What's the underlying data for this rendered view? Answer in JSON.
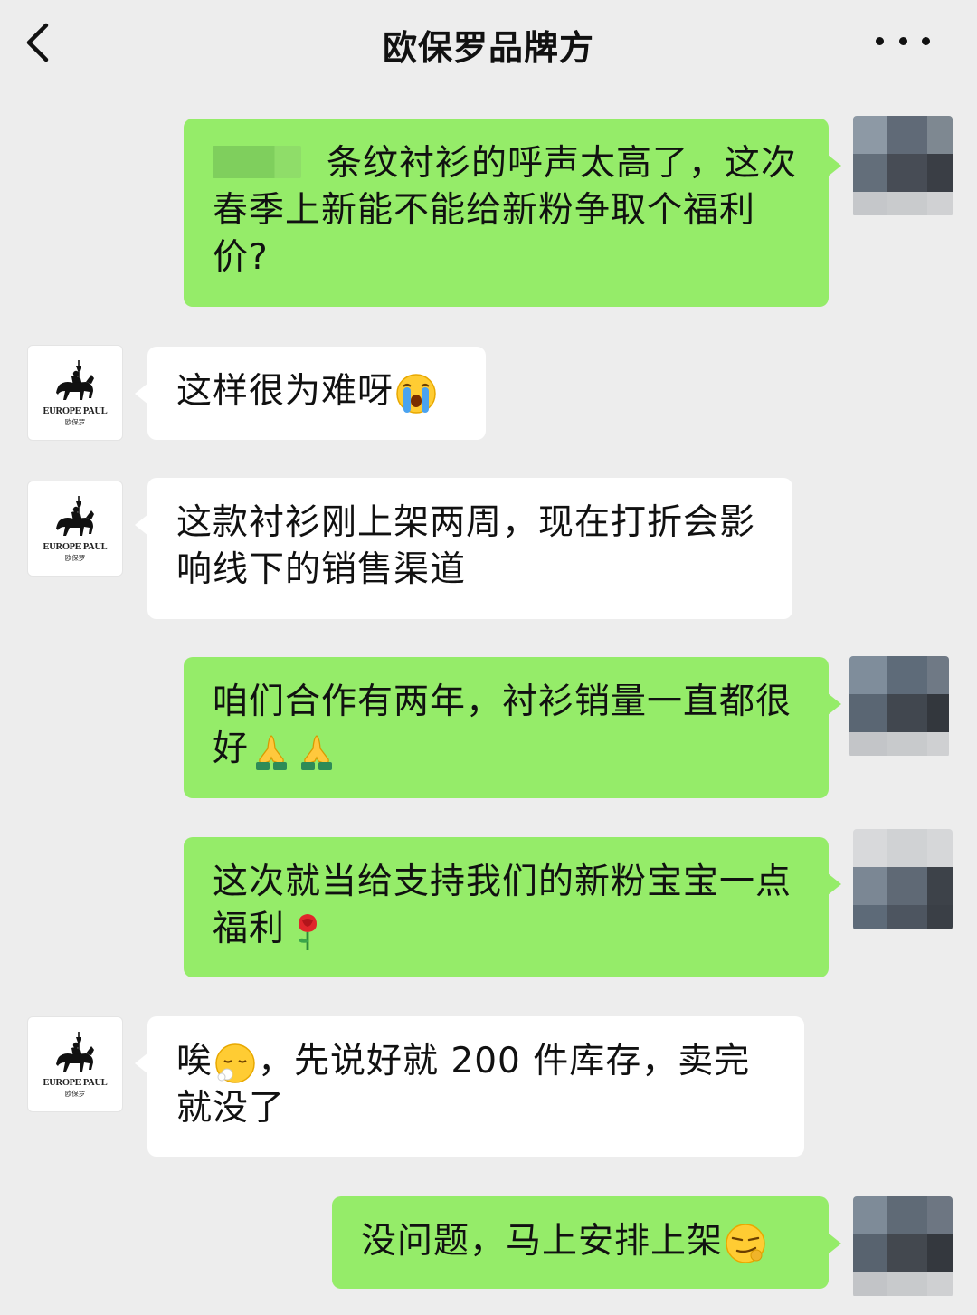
{
  "header": {
    "title": "欧保罗品牌方",
    "back_icon": "chevron-left-icon",
    "more_icon": "ellipsis-icon"
  },
  "brand_avatar": {
    "name": "EUROPE PAUL",
    "sub": "欧保罗"
  },
  "colors": {
    "outgoing_bubble": "#95ec69",
    "incoming_bubble": "#ffffff",
    "background": "#ededed"
  },
  "messages": [
    {
      "direction": "out",
      "redacted_prefix": true,
      "text": "条纹衬衫的呼声太高了，这次春季上新能不能给新粉争取个福利价?"
    },
    {
      "direction": "in",
      "text": "这样很为难呀",
      "emoji": "loudly-crying-face"
    },
    {
      "direction": "in",
      "text": "这款衬衫刚上架两周，现在打折会影响线下的销售渠道"
    },
    {
      "direction": "out",
      "text": "咱们合作有两年，衬衫销量一直都很好",
      "emoji": "folded-hands x2"
    },
    {
      "direction": "out",
      "text": "这次就当给支持我们的新粉宝宝一点福利",
      "emoji": "rose"
    },
    {
      "direction": "in",
      "text_before": "唉",
      "text": "，先说好就 200 件库存，卖完就没了",
      "emoji": "face-exhaling"
    },
    {
      "direction": "out",
      "text": "没问题，马上安排上架",
      "emoji": "smirking-face"
    }
  ]
}
